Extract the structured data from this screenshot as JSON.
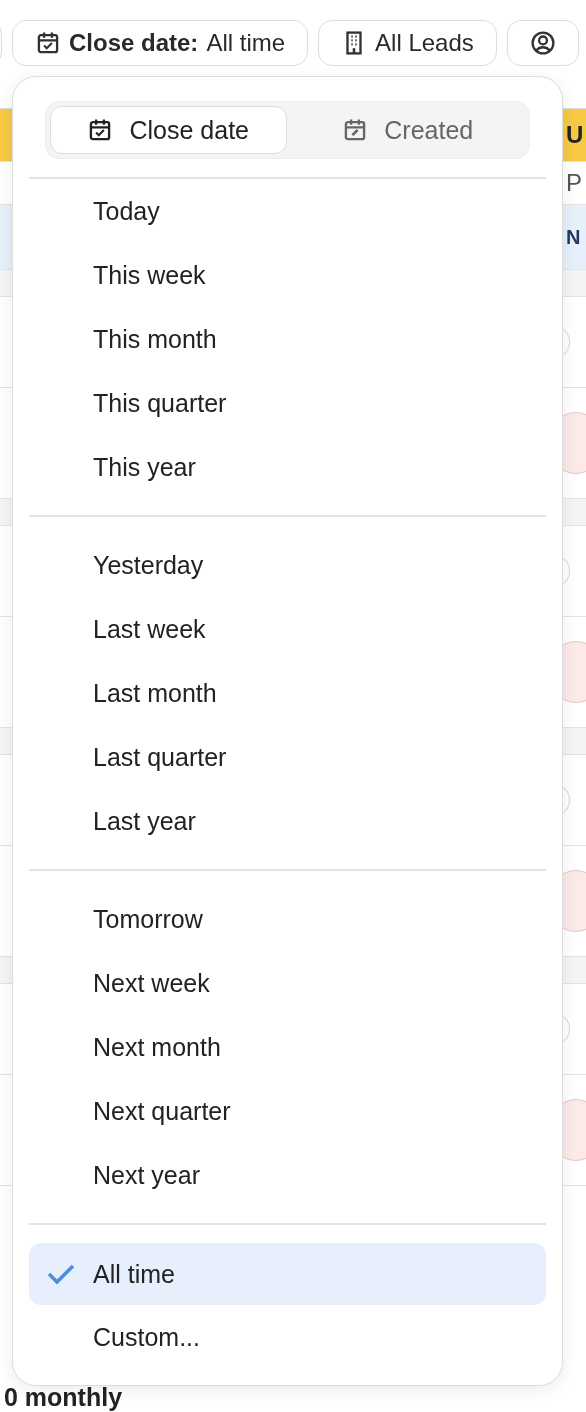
{
  "filters": [
    {
      "kind": "date",
      "label_bold": "Close date:",
      "label": "All time"
    },
    {
      "kind": "building",
      "label": "All Leads"
    },
    {
      "kind": "user"
    }
  ],
  "date_menu": {
    "tabs": [
      {
        "label": "Close date",
        "kind": "check",
        "selected": true
      },
      {
        "label": "Created",
        "kind": "edit",
        "selected": false
      }
    ],
    "groups": [
      [
        {
          "label": "Today",
          "selected": false
        },
        {
          "label": "This week",
          "selected": false
        },
        {
          "label": "This month",
          "selected": false
        },
        {
          "label": "This quarter",
          "selected": false
        },
        {
          "label": "This year",
          "selected": false
        }
      ],
      [
        {
          "label": "Yesterday",
          "selected": false
        },
        {
          "label": "Last week",
          "selected": false
        },
        {
          "label": "Last month",
          "selected": false
        },
        {
          "label": "Last quarter",
          "selected": false
        },
        {
          "label": "Last year",
          "selected": false
        }
      ],
      [
        {
          "label": "Tomorrow",
          "selected": false
        },
        {
          "label": "Next week",
          "selected": false
        },
        {
          "label": "Next month",
          "selected": false
        },
        {
          "label": "Next quarter",
          "selected": false
        },
        {
          "label": "Next year",
          "selected": false
        }
      ],
      [
        {
          "label": "All time",
          "selected": true
        },
        {
          "label": "Custom...",
          "selected": false
        }
      ]
    ]
  },
  "background": {
    "right_texts": [
      "U",
      "P",
      "N"
    ],
    "footer_text": "0 monthly"
  }
}
